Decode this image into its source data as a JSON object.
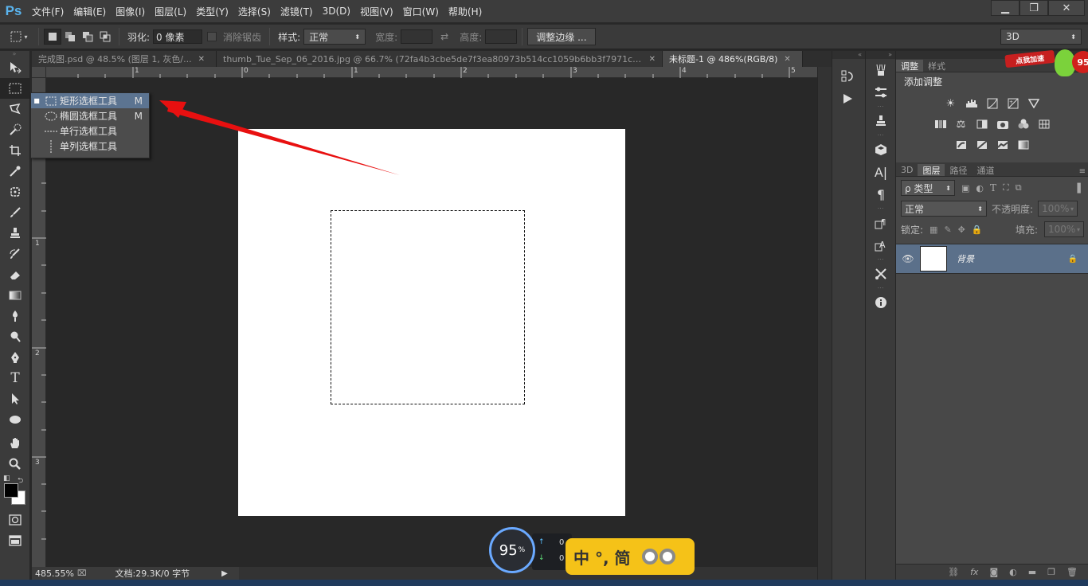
{
  "app": {
    "logo": "Ps"
  },
  "menu": [
    "文件(F)",
    "编辑(E)",
    "图像(I)",
    "图层(L)",
    "类型(Y)",
    "选择(S)",
    "滤镜(T)",
    "3D(D)",
    "视图(V)",
    "窗口(W)",
    "帮助(H)"
  ],
  "window_controls": {
    "minimize": "▁",
    "restore": "❐",
    "close": "✕"
  },
  "options": {
    "feather_label": "羽化:",
    "feather_value": "0 像素",
    "antialias_label": "消除锯齿",
    "style_label": "样式:",
    "style_value": "正常",
    "width_label": "宽度:",
    "height_label": "高度:",
    "refine_button": "调整边缘 ...",
    "workspace_value": "3D"
  },
  "doc_tabs": [
    {
      "label": "完成图.psd @ 48.5% (图层 1, 灰色/...",
      "active": false
    },
    {
      "label": "thumb_Tue_Sep_06_2016.jpg @ 66.7% (72fa4b3cbe5de7f3ea80973b514cc1059b6bb3f7971c0-J...",
      "active": false
    },
    {
      "label": "未标题-1 @ 486%(RGB/8)",
      "active": true
    }
  ],
  "ruler": {
    "top_labels": [
      "1",
      "0",
      "1",
      "2",
      "3",
      "4",
      "5"
    ],
    "left_labels": [
      "0",
      "1",
      "2",
      "3"
    ]
  },
  "flyout": {
    "items": [
      {
        "label": "矩形选框工具",
        "key": "M",
        "selected": true,
        "icon": "rect-marquee-icon"
      },
      {
        "label": "椭圆选框工具",
        "key": "M",
        "selected": false,
        "icon": "ellipse-marquee-icon"
      },
      {
        "label": "单行选框工具",
        "key": "",
        "selected": false,
        "icon": "single-row-marquee-icon"
      },
      {
        "label": "单列选框工具",
        "key": "",
        "selected": false,
        "icon": "single-column-marquee-icon"
      }
    ]
  },
  "status": {
    "zoom": "485.55%",
    "doc_info": "文档:29.3K/0 字节"
  },
  "panels": {
    "adjust_tabs": [
      "调整",
      "样式"
    ],
    "adjust_title": "添加调整",
    "layer_tabs": [
      "3D",
      "图层",
      "路径",
      "通道"
    ],
    "filter_kind": "ρ 类型",
    "blend_mode": "正常",
    "opacity_label": "不透明度:",
    "opacity_value": "100%",
    "lock_label": "锁定:",
    "fill_label": "填充:",
    "fill_value": "100%",
    "layer_name": "背景"
  },
  "overlays": {
    "badge_value": "95",
    "badge_unit": "%",
    "net_up": "0",
    "net_down": "0",
    "ime_text": "中 °, 简",
    "promo_text": "点我加速",
    "promo_value": "95"
  },
  "colors": {
    "accent_selection": "#5c7491",
    "arrow": "#e81010",
    "ime": "#f5c218"
  }
}
